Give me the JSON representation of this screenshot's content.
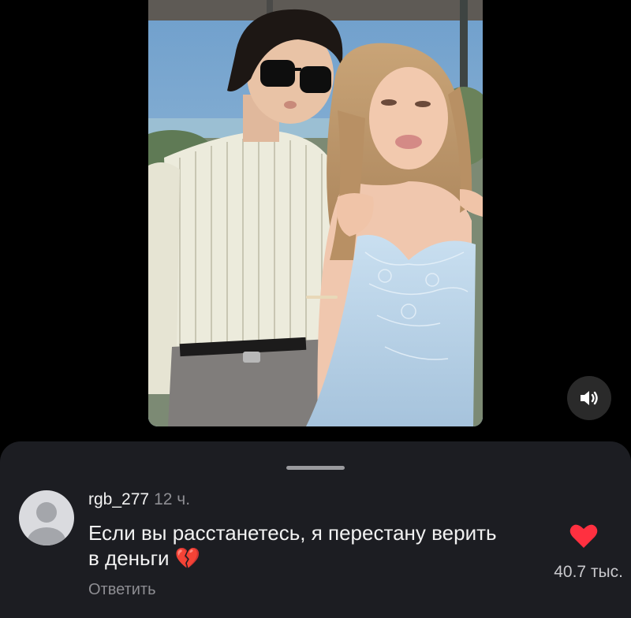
{
  "video": {
    "mute_icon": "speaker-icon"
  },
  "comment": {
    "username": "rgb_277",
    "timestamp": "12 ч.",
    "text": "Если вы расстанетесь, я перестану верить в деньги",
    "emoji": "💔",
    "reply_label": "Ответить",
    "like_count": "40.7 тыс.",
    "liked": true,
    "like_color": "#ff3040"
  },
  "colors": {
    "sheet_background": "#1c1d22",
    "page_background": "#000000"
  }
}
